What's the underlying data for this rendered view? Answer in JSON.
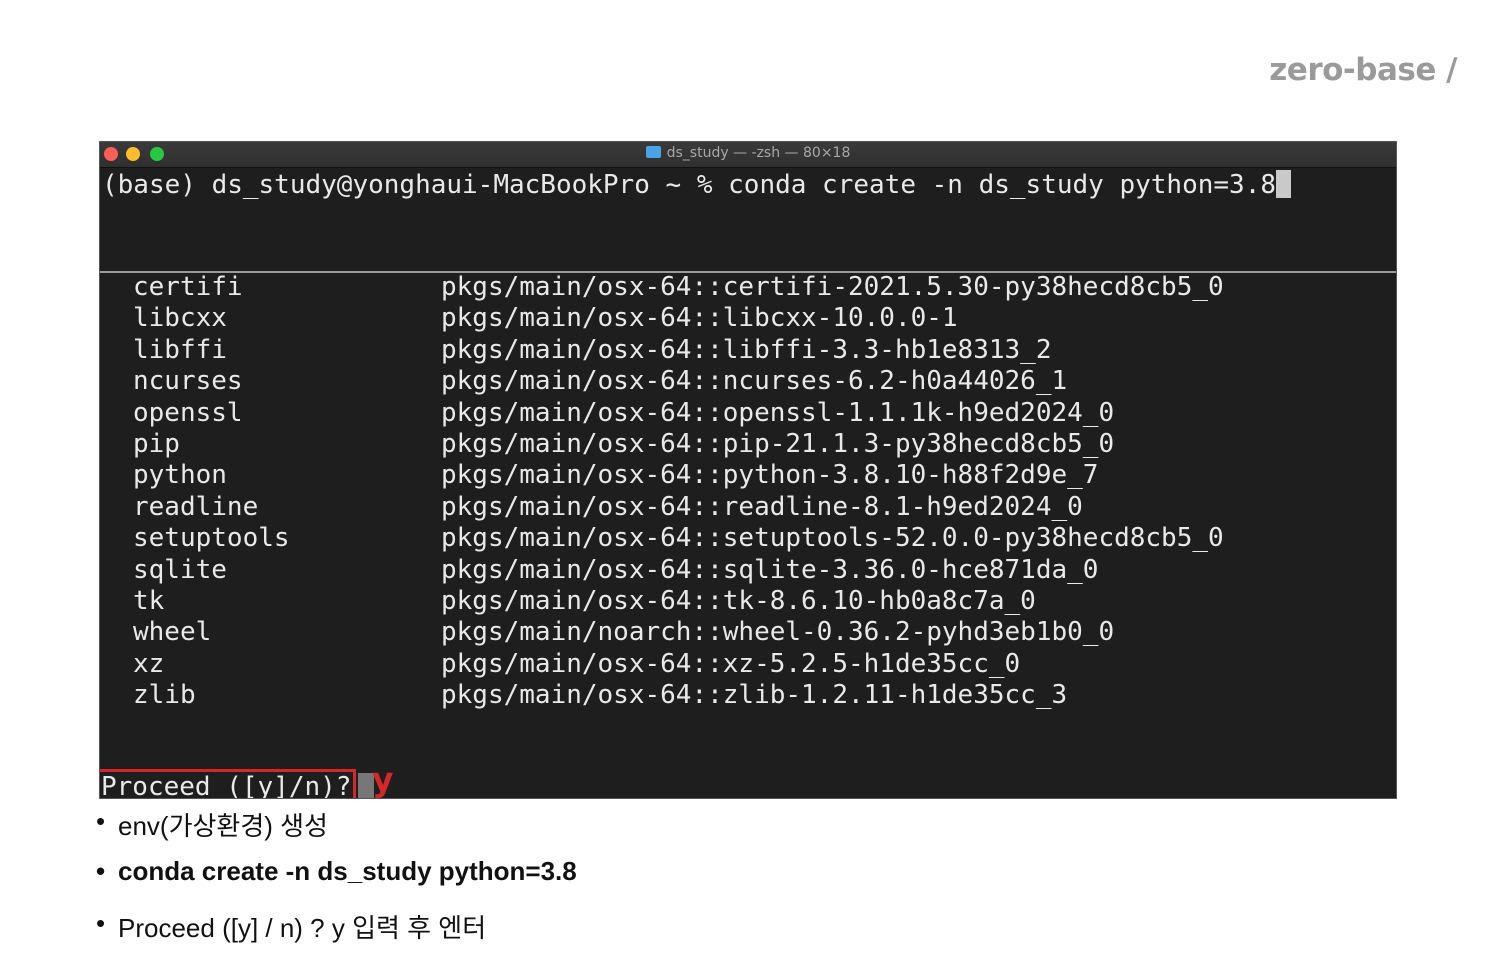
{
  "brand": {
    "logo_text": "zero-base /"
  },
  "terminal": {
    "title": "ds_study — -zsh — 80×18",
    "icons": {
      "title_icon": "folder-icon",
      "close": "close-icon",
      "minimize": "minimize-icon",
      "maximize": "maximize-icon"
    },
    "colors": {
      "background": "#1e1e1e",
      "text": "#e9e9e9",
      "highlight": "#d42727"
    },
    "command": "(base) ds_study@yonghaui-MacBookPro ~ % conda create -n ds_study python=3.8",
    "packages": [
      {
        "name": "certifi",
        "path": "pkgs/main/osx-64::certifi-2021.5.30-py38hecd8cb5_0"
      },
      {
        "name": "libcxx",
        "path": "pkgs/main/osx-64::libcxx-10.0.0-1"
      },
      {
        "name": "libffi",
        "path": "pkgs/main/osx-64::libffi-3.3-hb1e8313_2"
      },
      {
        "name": "ncurses",
        "path": "pkgs/main/osx-64::ncurses-6.2-h0a44026_1"
      },
      {
        "name": "openssl",
        "path": "pkgs/main/osx-64::openssl-1.1.1k-h9ed2024_0"
      },
      {
        "name": "pip",
        "path": "pkgs/main/osx-64::pip-21.1.3-py38hecd8cb5_0"
      },
      {
        "name": "python",
        "path": "pkgs/main/osx-64::python-3.8.10-h88f2d9e_7"
      },
      {
        "name": "readline",
        "path": "pkgs/main/osx-64::readline-8.1-h9ed2024_0"
      },
      {
        "name": "setuptools",
        "path": "pkgs/main/osx-64::setuptools-52.0.0-py38hecd8cb5_0"
      },
      {
        "name": "sqlite",
        "path": "pkgs/main/osx-64::sqlite-3.36.0-hce871da_0"
      },
      {
        "name": "tk",
        "path": "pkgs/main/osx-64::tk-8.6.10-hb0a8c7a_0"
      },
      {
        "name": "wheel",
        "path": "pkgs/main/noarch::wheel-0.36.2-pyhd3eb1b0_0"
      },
      {
        "name": "xz",
        "path": "pkgs/main/osx-64::xz-5.2.5-h1de35cc_0"
      },
      {
        "name": "zlib",
        "path": "pkgs/main/osx-64::zlib-1.2.11-h1de35cc_3"
      }
    ],
    "prompt": "Proceed ([y]/n)?",
    "typed_answer": "y"
  },
  "notes": [
    "env(가상환경) 생성",
    "conda create -n ds_study python=3.8",
    "Proceed ([y] / n) ? y 입력 후 엔터"
  ]
}
